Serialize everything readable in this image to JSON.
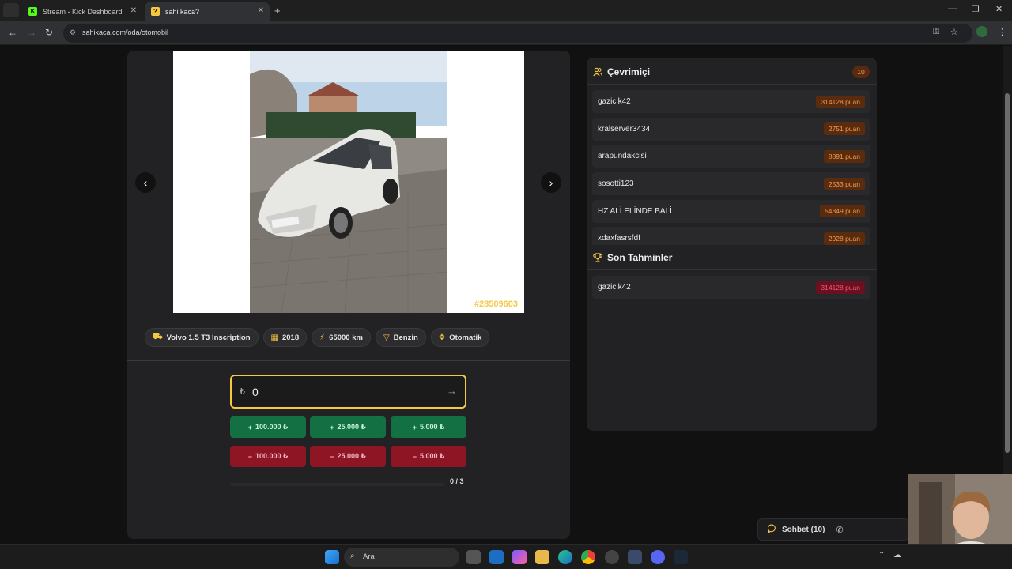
{
  "browser": {
    "tabs": [
      {
        "title": "Stream - Kick Dashboard",
        "active": false
      },
      {
        "title": "sahi kaca?",
        "active": true
      }
    ],
    "url": "sahikaca.com/oda/otomobil"
  },
  "game": {
    "photo_id": "#28509603",
    "chips": [
      {
        "icon": "car-icon",
        "label": "Volvo 1.5 T3 Inscription"
      },
      {
        "icon": "calendar-icon",
        "label": "2018"
      },
      {
        "icon": "bolt-icon",
        "label": "65000 km"
      },
      {
        "icon": "filter-icon",
        "label": "Benzin"
      },
      {
        "icon": "gear-shift-icon",
        "label": "Otomatik"
      }
    ],
    "price": {
      "currency": "₺",
      "value": "0"
    },
    "plus_buttons": [
      "100.000 ₺",
      "25.000 ₺",
      "5.000 ₺"
    ],
    "minus_buttons": [
      "100.000 ₺",
      "25.000 ₺",
      "5.000 ₺"
    ],
    "attempts": "0 / 3"
  },
  "online": {
    "title": "Çevrimiçi",
    "count": "10",
    "users": [
      {
        "name": "gaziclk42",
        "points": "314128 puan"
      },
      {
        "name": "kralserver3434",
        "points": "2751 puan"
      },
      {
        "name": "arapundakcisi",
        "points": "8891 puan"
      },
      {
        "name": "sosotti123",
        "points": "2533 puan"
      },
      {
        "name": "HZ ALİ ELİNDE BALİ",
        "points": "54349 puan"
      },
      {
        "name": "xdaxfasrsfdf",
        "points": "2928 puan"
      }
    ]
  },
  "recent": {
    "title": "Son Tahminler",
    "guesses": [
      {
        "name": "gaziclk42",
        "points": "314128 puan"
      }
    ]
  },
  "chat": {
    "label": "Sohbet (10)"
  },
  "taskbar": {
    "search_label": "Ara"
  },
  "colors": {
    "accent": "#f5c842",
    "plus": "#127042",
    "minus": "#8e1524",
    "panel": "#222224"
  }
}
